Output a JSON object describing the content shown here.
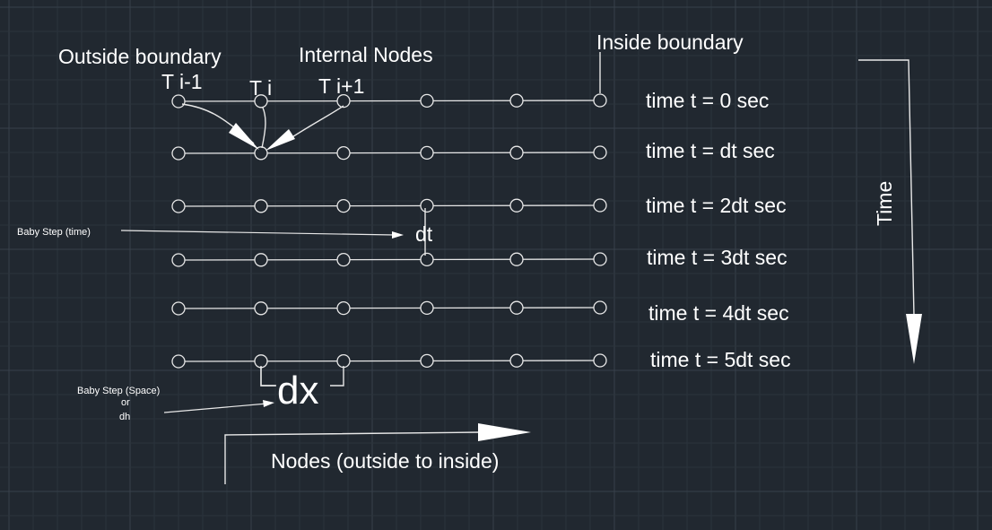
{
  "colors": {
    "background": "#212830",
    "grid_minor": "#2b333c",
    "grid_major": "#37404a",
    "line": "#e8e8e8",
    "text": "#ffffff"
  },
  "labels": {
    "outside_boundary": "Outside boundary",
    "internal_nodes": "Internal Nodes",
    "inside_boundary": "Inside boundary",
    "t_im1": "T i-1",
    "t_i": "T i",
    "t_ip1": "T i+1",
    "time_axis": "Time",
    "nodes_axis": "Nodes (outside to inside)",
    "dt": "dt",
    "dx": "dx",
    "baby_step_time": "Baby Step (time)",
    "baby_step_space_1": "Baby Step (Space)",
    "baby_step_space_2": "or",
    "baby_step_space_3": "dh"
  },
  "time_rows": [
    "time t = 0 sec",
    "time t = dt sec",
    "time t = 2dt sec",
    "time t = 3dt sec",
    "time t = 4dt sec",
    "time t = 5dt sec"
  ],
  "nodes_per_row": 6
}
